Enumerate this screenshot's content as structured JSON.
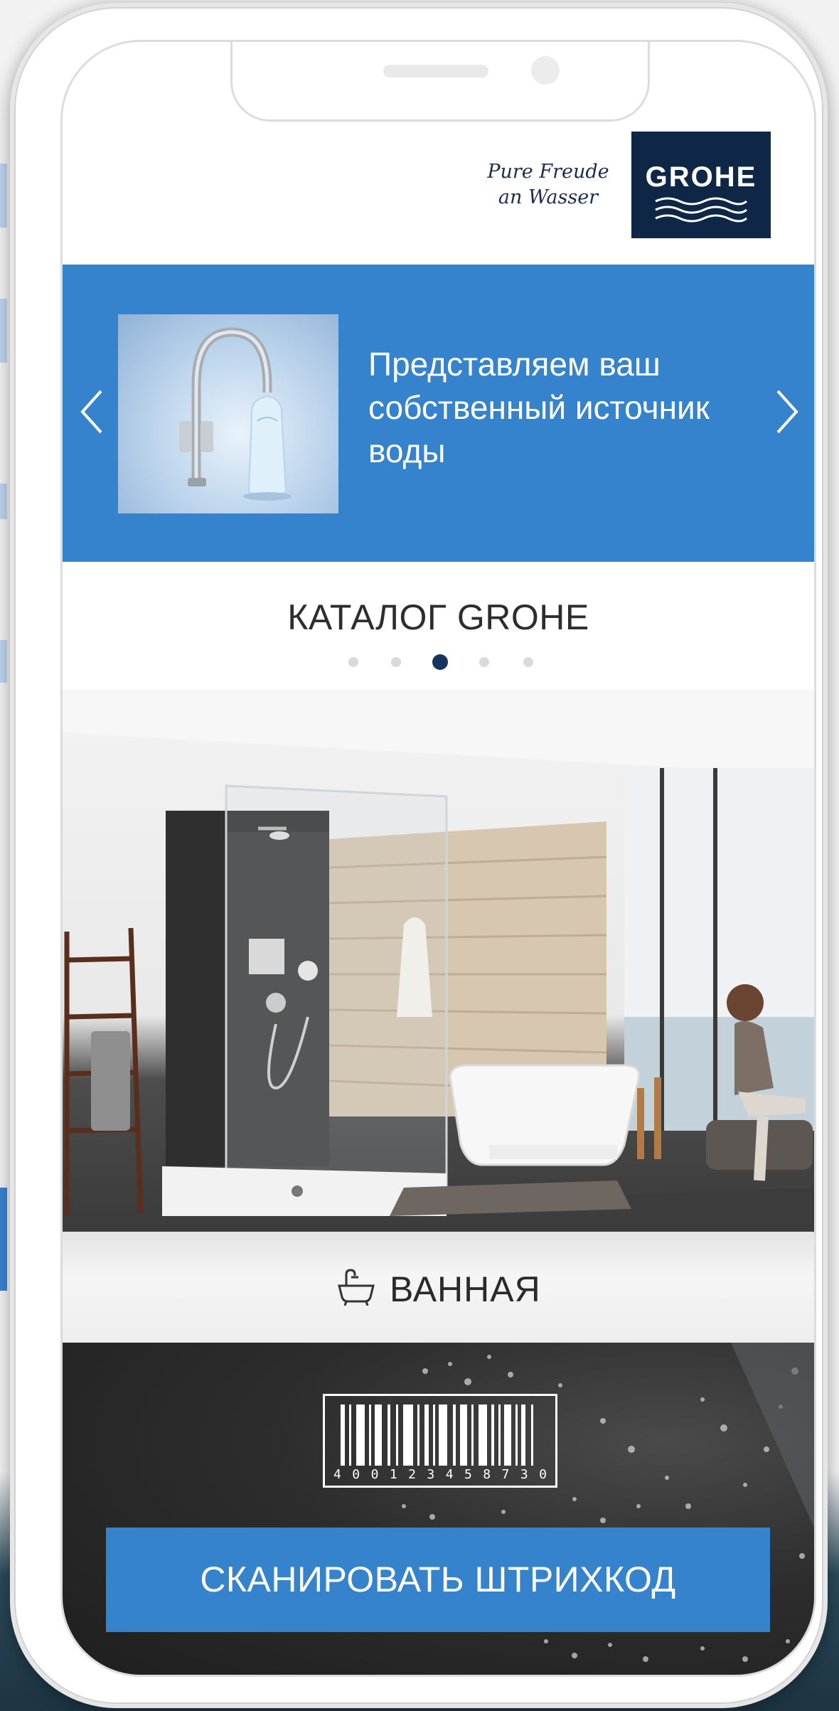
{
  "brand": {
    "tagline_line1": "Pure Freude",
    "tagline_line2": "an Wasser",
    "logo_text": "GROHE",
    "logo_color": "#0f2746"
  },
  "banner": {
    "text_line1": "Представляем ваш",
    "text_line2": "собственный источник",
    "text_line3": "воды",
    "background_color": "#3583cc",
    "prev_icon": "chevron-left-icon",
    "next_icon": "chevron-right-icon"
  },
  "catalog": {
    "title": "КАТАЛОГ GROHE",
    "pagination_total": 5,
    "pagination_active": 3
  },
  "category": {
    "icon": "bathtub-icon",
    "label": "ВАННАЯ"
  },
  "scan": {
    "barcode_digits": [
      "4",
      "0",
      "0",
      "1",
      "2",
      "3",
      "4",
      "5",
      "8",
      "7",
      "3",
      "0"
    ],
    "button_label": "СКАНИРОВАТЬ ШТРИХКОД",
    "button_color": "#3583cc"
  }
}
